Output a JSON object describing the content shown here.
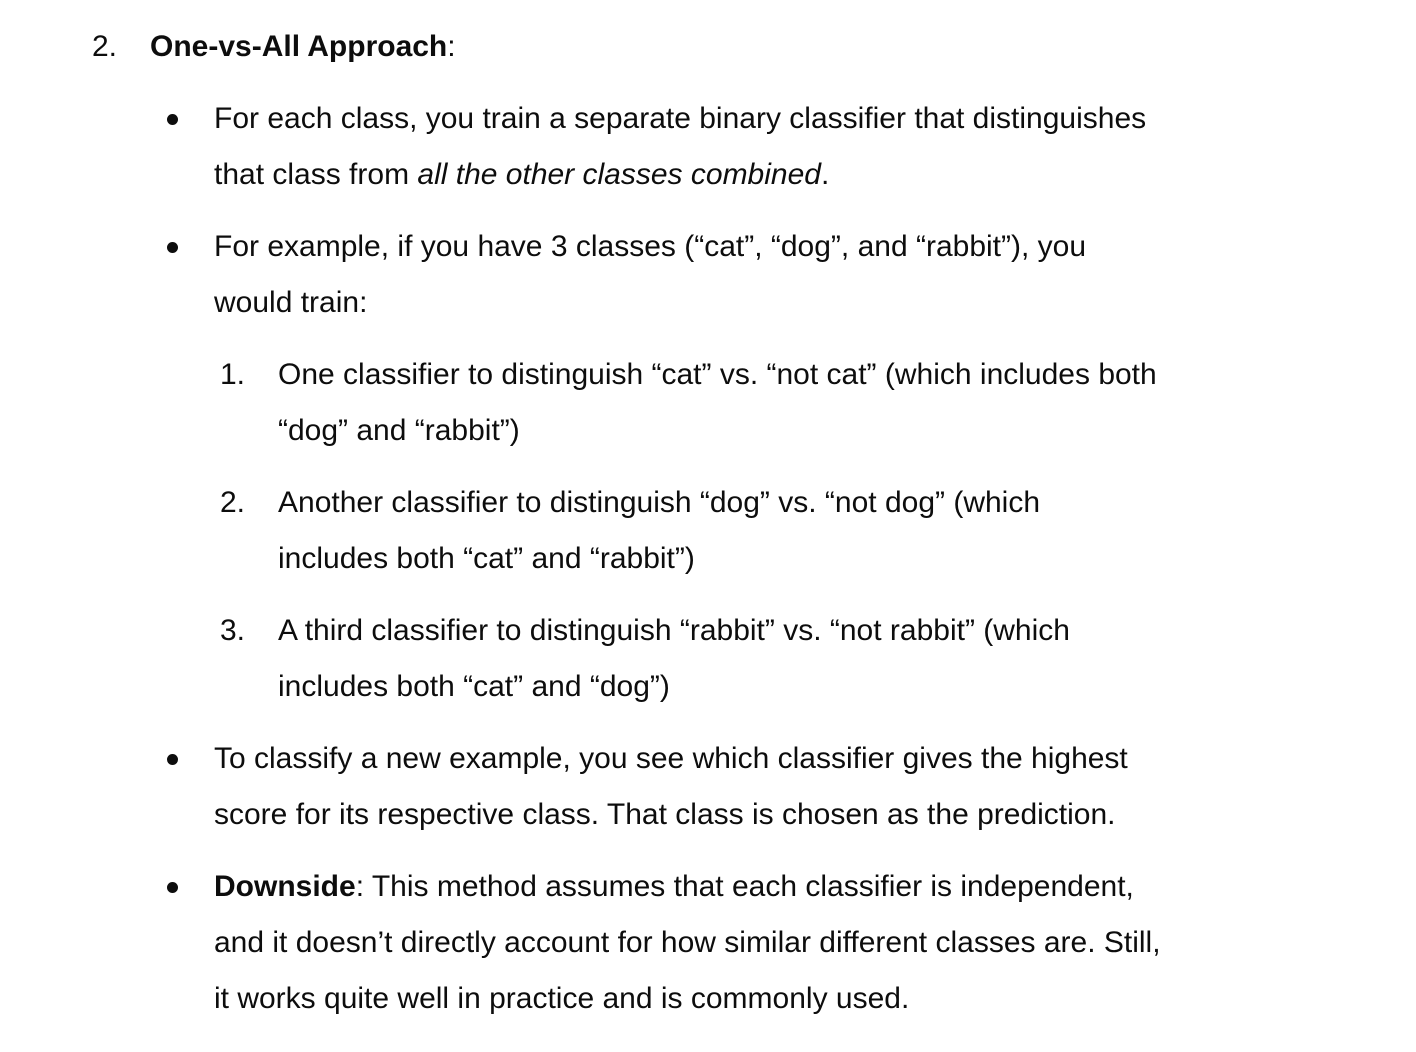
{
  "heading": {
    "number": "2.",
    "title": "One-vs-All Approach",
    "suffix": ":"
  },
  "bullets": [
    {
      "lines": [
        "For each class, you train a separate binary classifier that distinguishes"
      ],
      "line2_pre": "that class from ",
      "line2_em": "all the other classes combined",
      "line2_post": "."
    },
    {
      "lines": [
        "For example, if you have 3 classes (“cat”, “dog”, and “rabbit”), you",
        "would train:"
      ]
    },
    {
      "lines": [
        "To classify a new example, you see which classifier gives the highest",
        "score for its respective class. That class is chosen as the prediction."
      ]
    },
    {
      "bold": "Downside",
      "rest": ": This method assumes that each classifier is independent,",
      "lines": [
        "and it doesn’t directly account for how similar different classes are. Still,",
        "it works quite well in practice and is commonly used."
      ]
    }
  ],
  "sublist": [
    {
      "number": "1.",
      "lines": [
        "One classifier to distinguish “cat” vs. “not cat” (which includes both",
        "“dog” and “rabbit”)"
      ]
    },
    {
      "number": "2.",
      "lines": [
        "Another classifier to distinguish “dog” vs. “not dog” (which",
        "includes both “cat” and “rabbit”)"
      ]
    },
    {
      "number": "3.",
      "lines": [
        "A third classifier to distinguish “rabbit” vs. “not rabbit” (which",
        "includes both “cat” and “dog”)"
      ]
    }
  ]
}
